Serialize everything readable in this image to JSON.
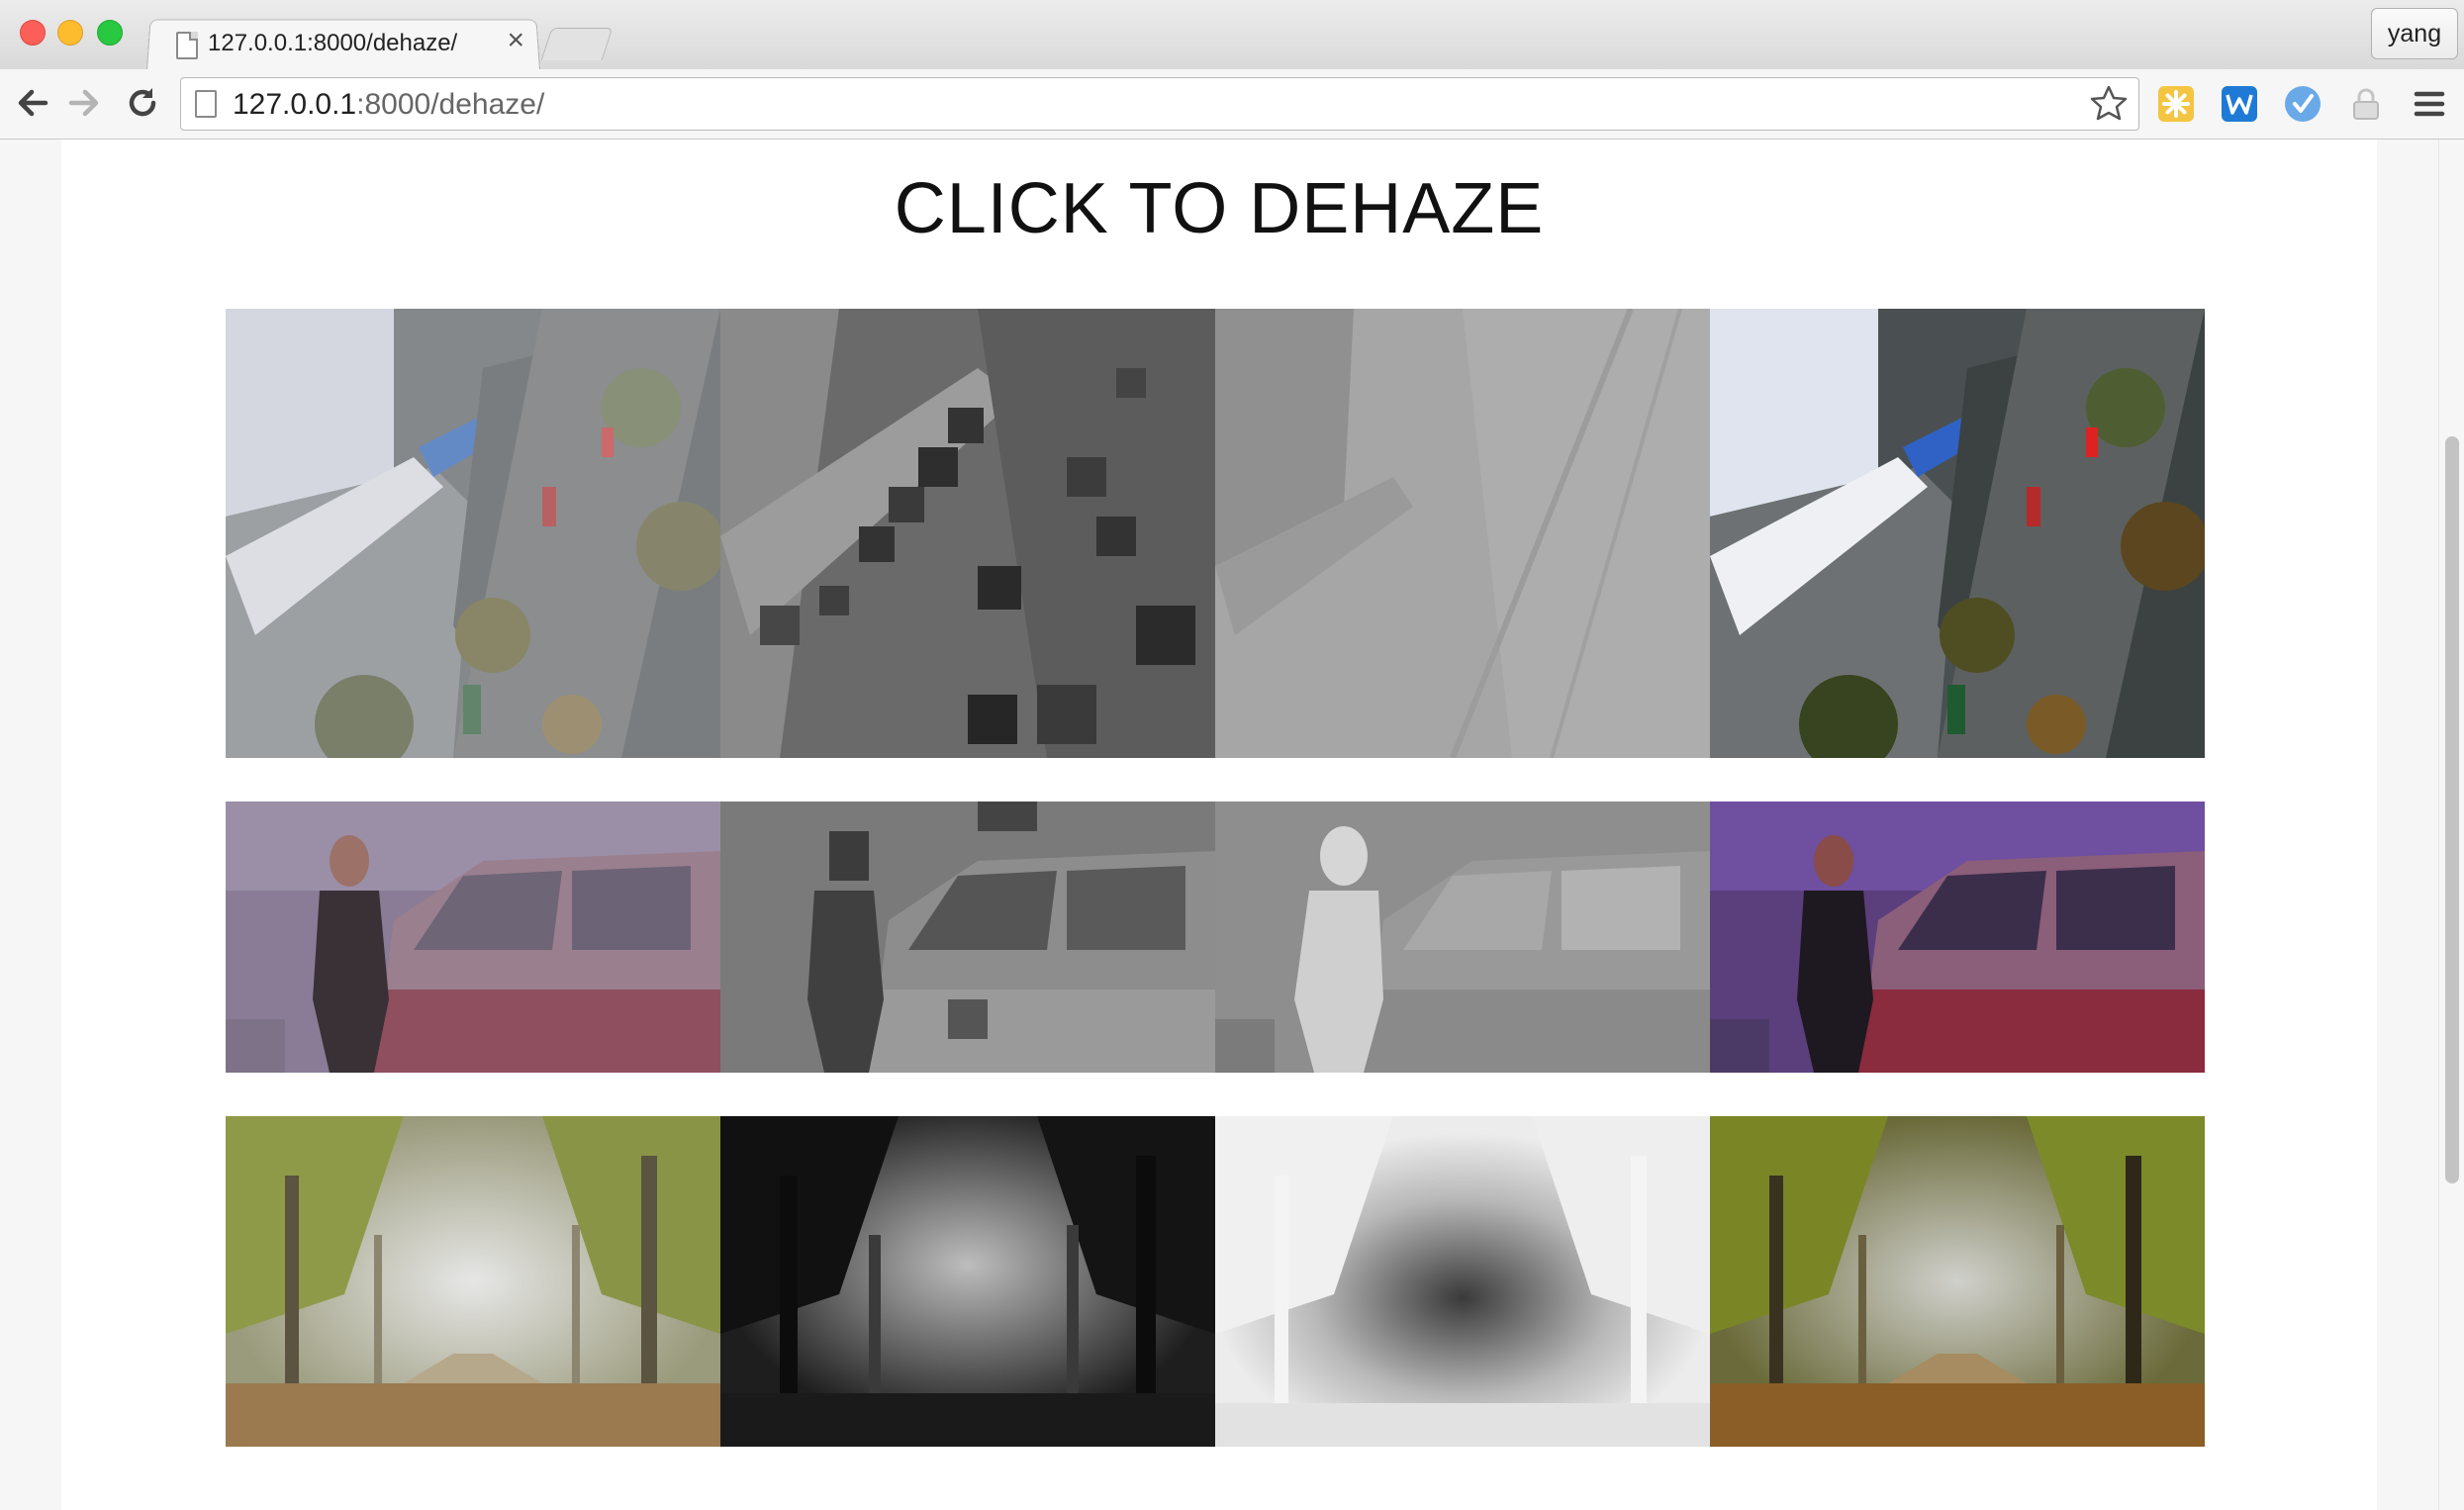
{
  "browser": {
    "tab": {
      "title": "127.0.0.1:8000/dehaze/",
      "close": "×"
    },
    "profile": "yang",
    "address": {
      "host": "127.0.0.1",
      "rest": ":8000/dehaze/"
    }
  },
  "page": {
    "title": "CLICK TO DEHAZE",
    "rows": [
      {
        "scene": "aerial-city-street",
        "columns": [
          "hazy-input",
          "dark-channel",
          "transmission-map",
          "dehazed-output"
        ]
      },
      {
        "scene": "man-beside-red-jeep",
        "columns": [
          "hazy-input",
          "dark-channel",
          "transmission-map",
          "dehazed-output"
        ]
      },
      {
        "scene": "misty-forest-path",
        "columns": [
          "hazy-input",
          "dark-channel",
          "transmission-map",
          "dehazed-output"
        ]
      }
    ]
  },
  "colors": {
    "page_background": "#ffffff",
    "title_text": "#111111",
    "chrome_background": "#f6f6f6"
  },
  "icons": {
    "back": "arrow-left-icon",
    "forward": "arrow-right-icon",
    "reload": "reload-icon",
    "bookmark": "star-icon",
    "menu": "hamburger-menu-icon"
  }
}
